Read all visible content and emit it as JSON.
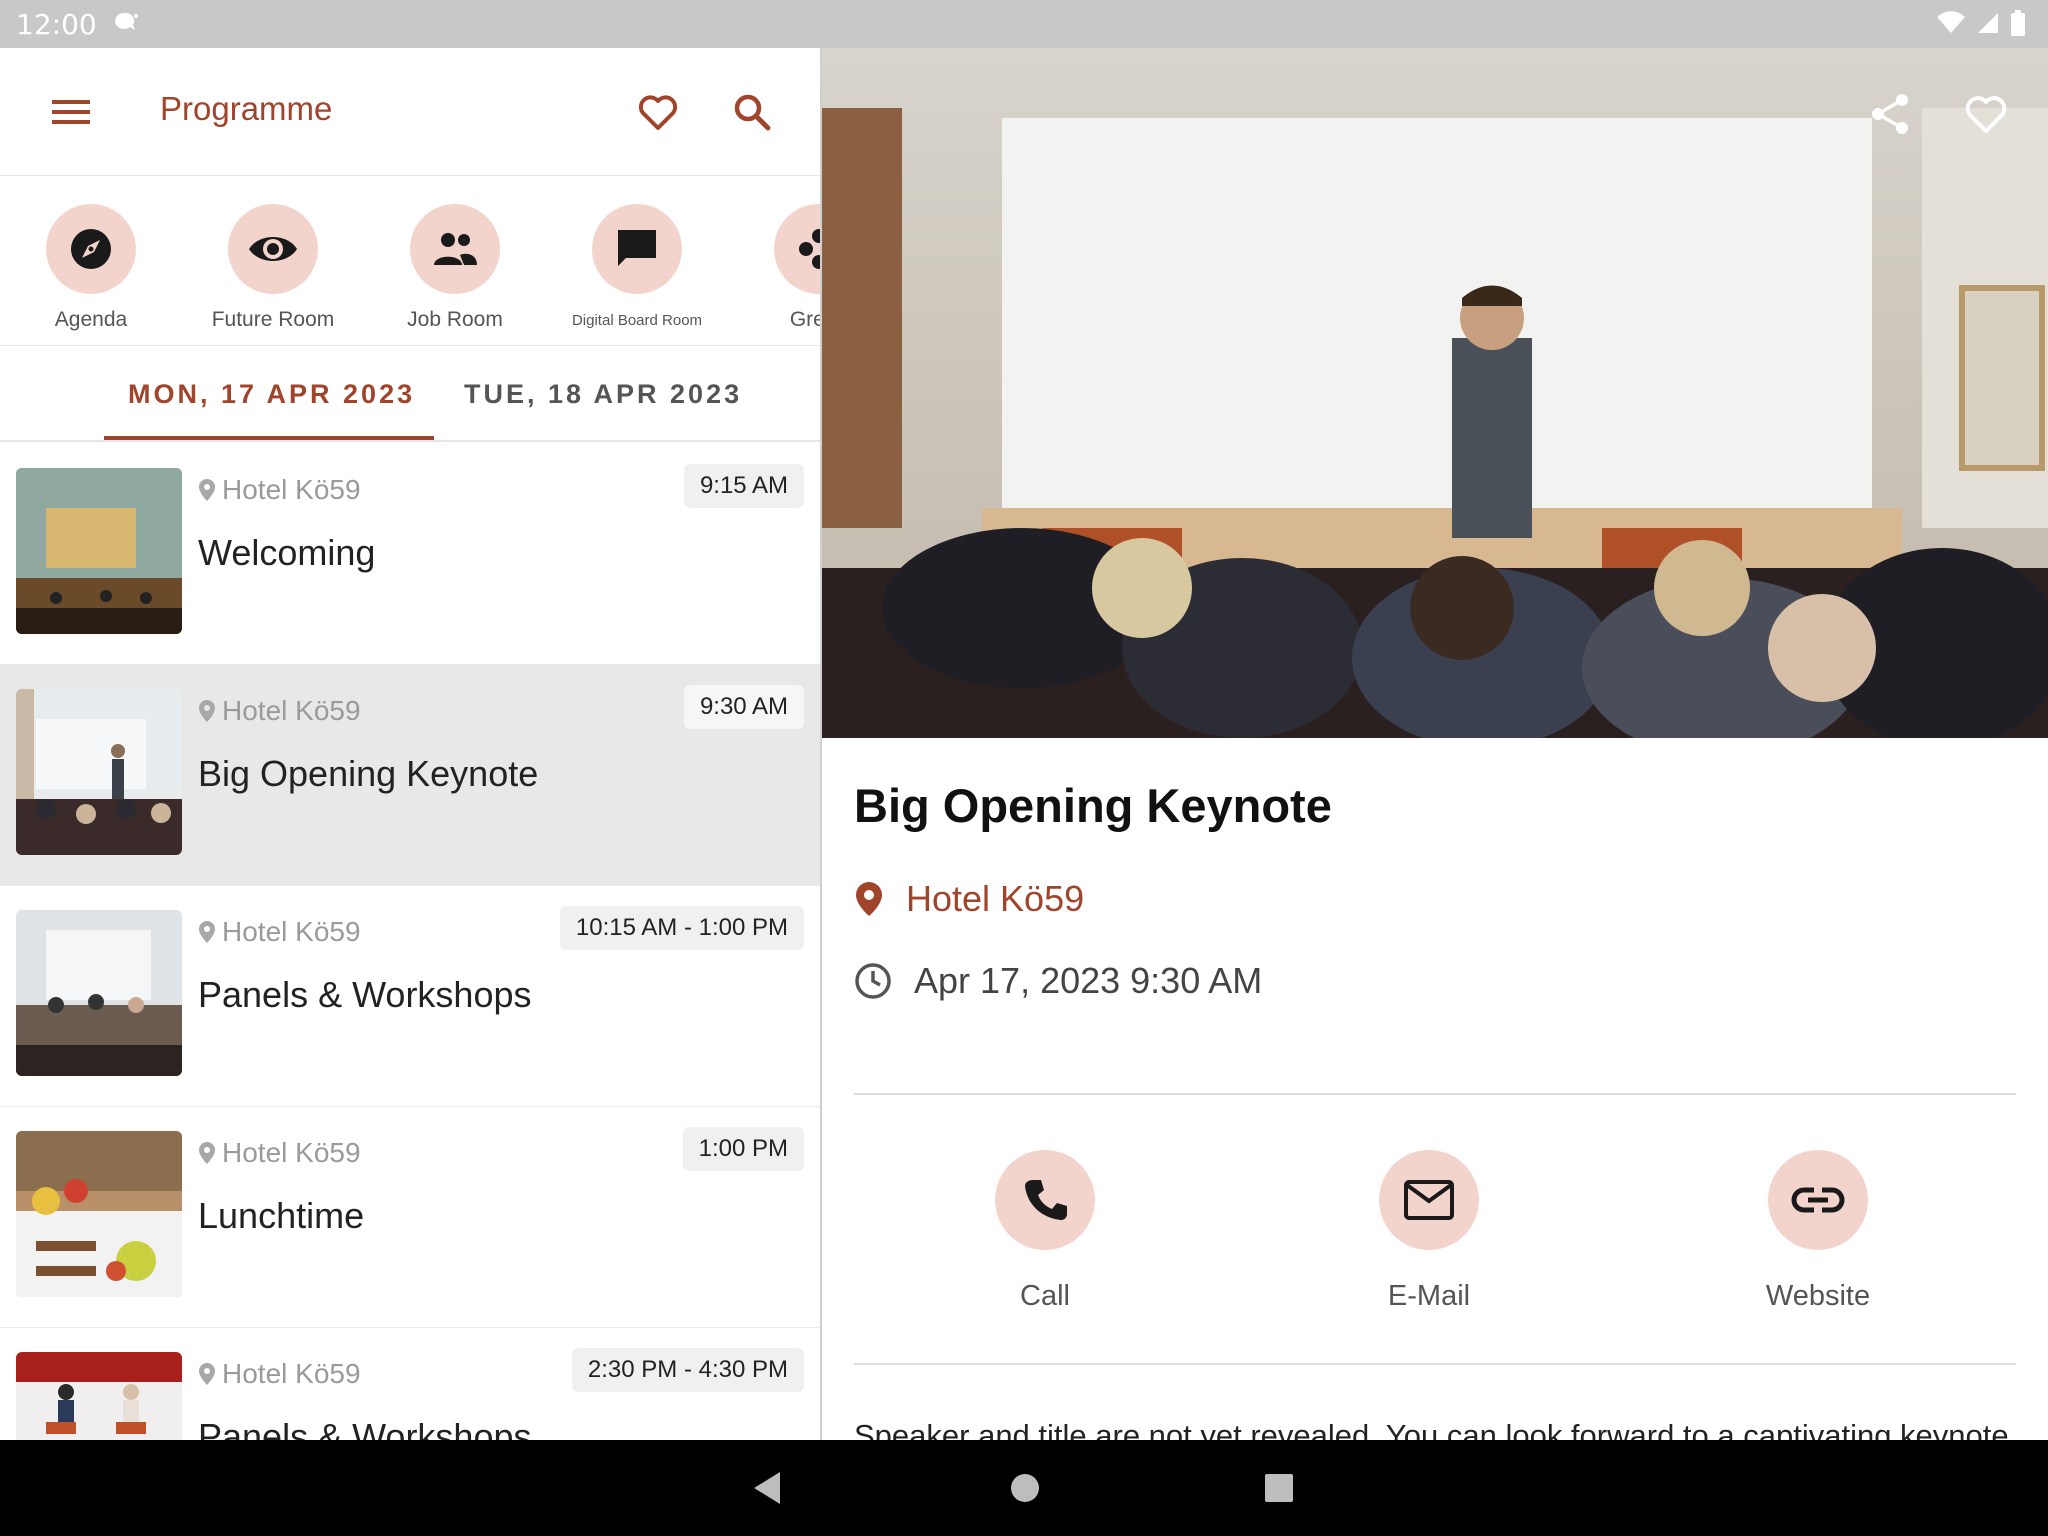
{
  "status": {
    "time": "12:00"
  },
  "appbar": {
    "title": "Programme"
  },
  "rooms": [
    {
      "label": "Agenda",
      "icon": "compass-icon"
    },
    {
      "label": "Future Room",
      "icon": "eye-icon"
    },
    {
      "label": "Job Room",
      "icon": "people-icon"
    },
    {
      "label": "Digital Board Room",
      "icon": "chat-icon"
    },
    {
      "label": "Green",
      "icon": "flower-icon"
    }
  ],
  "tabs": [
    {
      "label": "MON, 17 APR 2023",
      "active": true
    },
    {
      "label": "TUE, 18 APR 2023",
      "active": false
    }
  ],
  "sessions": [
    {
      "location": "Hotel Kö59",
      "time": "9:15 AM",
      "title": "Welcoming"
    },
    {
      "location": "Hotel Kö59",
      "time": "9:30 AM",
      "title": "Big Opening Keynote"
    },
    {
      "location": "Hotel Kö59",
      "time": "10:15 AM - 1:00 PM",
      "title": "Panels & Workshops"
    },
    {
      "location": "Hotel Kö59",
      "time": "1:00 PM",
      "title": "Lunchtime"
    },
    {
      "location": "Hotel Kö59",
      "time": "2:30 PM - 4:30 PM",
      "title": "Panels & Workshops"
    }
  ],
  "detail": {
    "title": "Big Opening Keynote",
    "location": "Hotel Kö59",
    "datetime": "Apr 17, 2023 9:30 AM",
    "actions": [
      {
        "label": "Call",
        "icon": "phone-icon"
      },
      {
        "label": "E-Mail",
        "icon": "mail-icon"
      },
      {
        "label": "Website",
        "icon": "link-icon"
      }
    ],
    "description": "Speaker and title are not yet revealed.  You can look forward to a captivating keynote in the morning."
  },
  "colors": {
    "accent": "#a0442c",
    "accent_soft": "#f3d4cc",
    "selected_row": "#e8e8e8"
  }
}
